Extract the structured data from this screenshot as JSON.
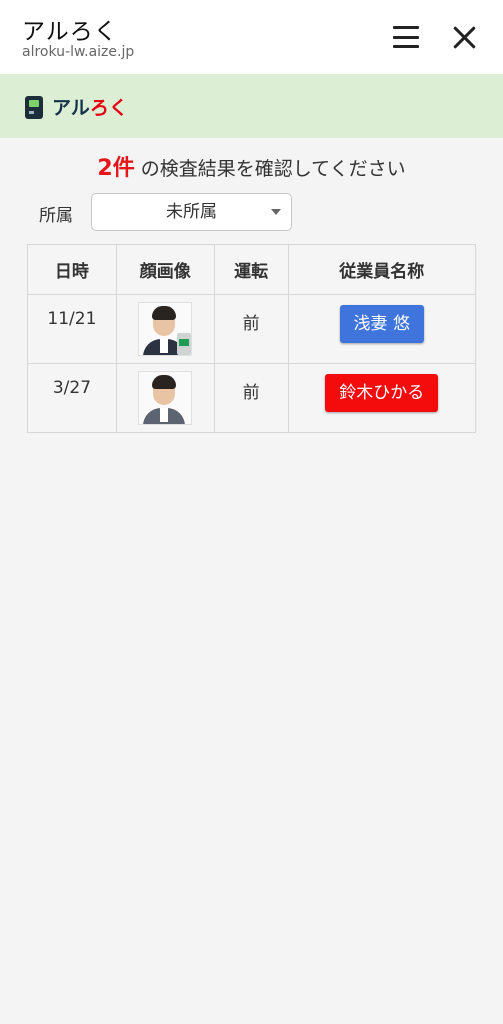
{
  "window": {
    "title": "アルろく",
    "url": "alroku-lw.aize.jp"
  },
  "brand": {
    "name_part1": "アル",
    "name_part2": "ろく",
    "icon": "phone-device-icon"
  },
  "heading": {
    "count": "2件",
    "text": " の検査結果を確認してください"
  },
  "filter": {
    "label": "所属",
    "selected": "未所属"
  },
  "table": {
    "headers": [
      "日時",
      "顔画像",
      "運転",
      "従業員名称"
    ],
    "rows": [
      {
        "date": "11/21",
        "drive": "前",
        "name": "浅妻 悠",
        "color": "#3f74dd"
      },
      {
        "date": "3/27",
        "drive": "前",
        "name": "鈴木ひかる",
        "color": "#f40c0c"
      }
    ]
  },
  "colors": {
    "brand_bar": "#dcefd5",
    "accent_red": "#e5161b",
    "button_blue": "#3f74dd",
    "button_red": "#f40c0c"
  }
}
